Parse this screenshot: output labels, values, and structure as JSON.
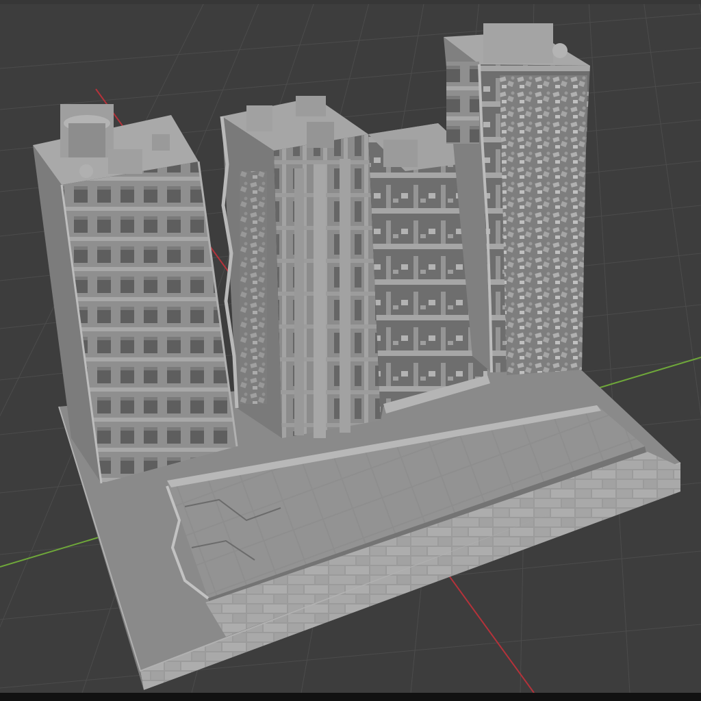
{
  "viewport": {
    "background": "#3d3d3d",
    "grid_color": "#4c4c4c",
    "x_axis_color": "#b5323a",
    "y_axis_color": "#6fa83a"
  },
  "model": {
    "material_color": "#9a9a9a",
    "parts": [
      "intact-tower",
      "damaged-tower",
      "collapsed-block",
      "collapsed-tower",
      "street-base",
      "road-slab",
      "stone-edge"
    ]
  }
}
